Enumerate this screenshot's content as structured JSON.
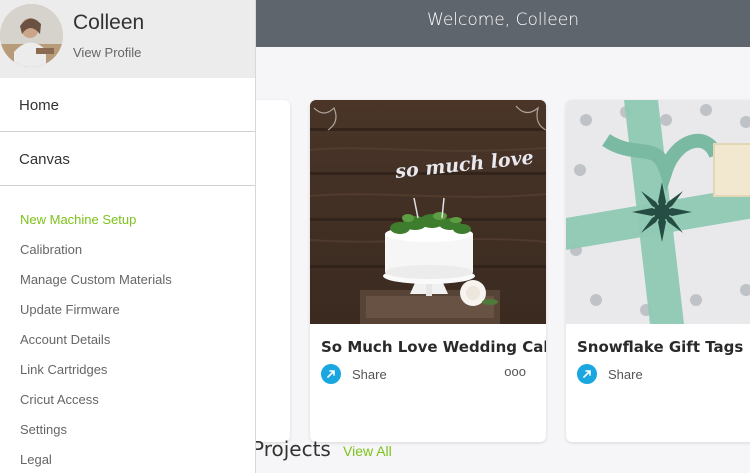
{
  "header": {
    "welcome": "Welcome, Colleen"
  },
  "profile": {
    "name": "Colleen",
    "view_profile": "View Profile"
  },
  "nav": {
    "main_items": [
      {
        "label": "Home"
      },
      {
        "label": "Canvas"
      }
    ],
    "sub_items": [
      {
        "label": "New Machine Setup",
        "active": true
      },
      {
        "label": "Calibration"
      },
      {
        "label": "Manage Custom Materials"
      },
      {
        "label": "Update Firmware"
      },
      {
        "label": "Account Details"
      },
      {
        "label": "Link Cartridges"
      },
      {
        "label": "Cricut Access"
      },
      {
        "label": "Settings"
      },
      {
        "label": "Legal"
      }
    ]
  },
  "cards": [
    {
      "title": "So Much Love Wedding Cake T",
      "share_label": "Share",
      "more": "ooo",
      "cake_topper": "so much love"
    },
    {
      "title": "Snowflake Gift Tags",
      "share_label": "Share"
    }
  ],
  "projects": {
    "title": "Projects",
    "view_all": "View All"
  },
  "colors": {
    "accent": "#7ec21b",
    "share_blue": "#1aa7e0",
    "header": "#5f656c"
  }
}
